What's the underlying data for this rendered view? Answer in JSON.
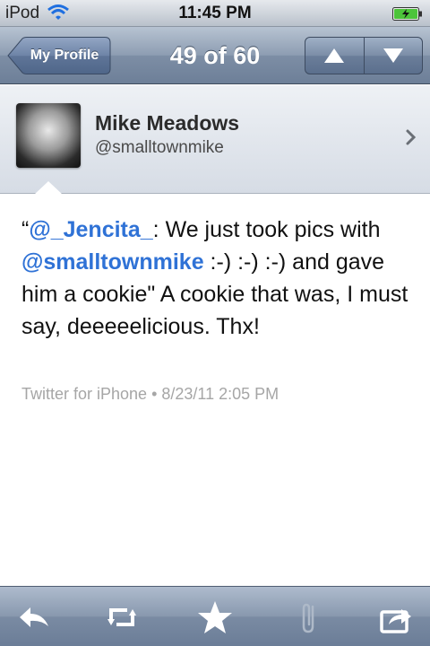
{
  "status_bar": {
    "carrier": "iPod",
    "time": "11:45 PM"
  },
  "nav": {
    "back_label": "My Profile",
    "title": "49 of 60"
  },
  "profile": {
    "name": "Mike Meadows",
    "handle": "@smalltownmike"
  },
  "tweet": {
    "open_quote": "“",
    "mention1": "@_Jencita_",
    "text1": ": We just took pics with ",
    "mention2": "@smalltownmike",
    "text2": " :-) :-) :-) and gave him a cookie\" A cookie that was, I must say, deeeeelicious. Thx!",
    "meta": "Twitter for iPhone • 8/23/11 2:05 PM"
  },
  "toolbar": {
    "icons": [
      "reply-icon",
      "retweet-icon",
      "star-icon",
      "attachment-icon",
      "share-icon"
    ]
  },
  "colors": {
    "mention": "#2f72d6",
    "nav_bar": "#7d8ea5",
    "meta_text": "#a6a6a6"
  }
}
